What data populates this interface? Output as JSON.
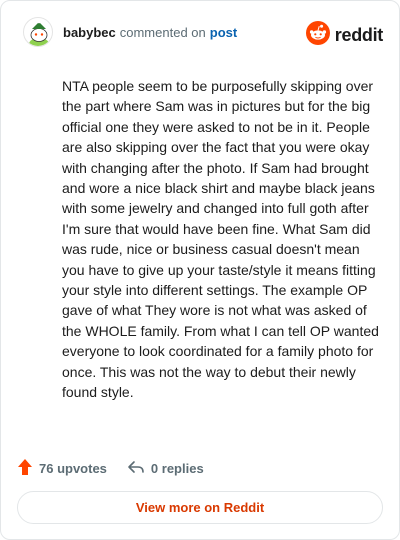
{
  "header": {
    "username": "babybec",
    "action": "commented on",
    "link": "post",
    "logo_text": "reddit"
  },
  "comment": {
    "text": "NTA people seem to be purposefully skipping over the part where Sam was in pictures but for the big official one they were asked to not be in it. People are also skipping over the fact that you were okay with changing after the photo. If Sam had brought and wore a nice black shirt and maybe black jeans with some jewelry and changed into full goth after I'm sure that would have been fine. What Sam did was rude, nice or business casual doesn't mean you have to give up your taste/style it means fitting your style into different settings. The example OP gave of what They wore is not what was asked of the WHOLE family. From what I can tell OP wanted everyone to look coordinated for a family photo for once. This was not the way to debut their newly found style."
  },
  "footer": {
    "upvotes": "76 upvotes",
    "replies": "0 replies",
    "view_more": "View more on Reddit"
  },
  "icons": {
    "avatar": "snoo-avatar-icon",
    "logo": "reddit-snoo-logo-icon",
    "upvote": "upvote-arrow-icon",
    "reply": "reply-arrow-icon"
  },
  "colors": {
    "brand": "#ff4500",
    "link": "#0a63b0",
    "view_more": "#d93900",
    "muted": "#5c6c74"
  }
}
